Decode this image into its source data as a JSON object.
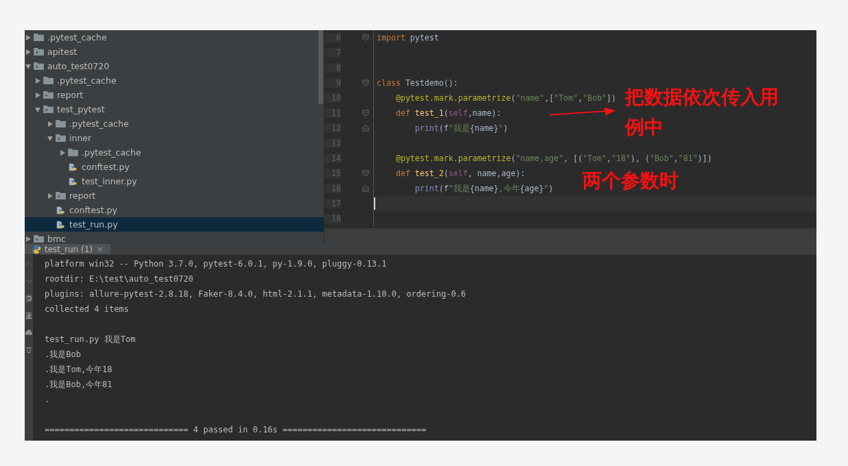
{
  "project_tree": [
    {
      "label": ".pytest_cache",
      "kind": "folder",
      "expanded": false,
      "selected": false
    },
    {
      "label": "apitest",
      "kind": "folder",
      "expanded": false,
      "selected": false
    },
    {
      "label": "auto_test0720",
      "kind": "folder",
      "expanded": true,
      "selected": false,
      "children": [
        {
          "label": ".pytest_cache",
          "kind": "folder",
          "expanded": false,
          "selected": false
        },
        {
          "label": "report",
          "kind": "folder",
          "expanded": false,
          "selected": false
        },
        {
          "label": "test_pytest",
          "kind": "folder",
          "expanded": true,
          "selected": false,
          "children": [
            {
              "label": ".pytest_cache",
              "kind": "folder",
              "expanded": false,
              "selected": false
            },
            {
              "label": "inner",
              "kind": "folder",
              "expanded": true,
              "selected": false,
              "children": [
                {
                  "label": ".pytest_cache",
                  "kind": "folder",
                  "expanded": false,
                  "selected": false
                },
                {
                  "label": "conftest.py",
                  "kind": "file",
                  "selected": false
                },
                {
                  "label": "test_inner.py",
                  "kind": "file",
                  "selected": false
                }
              ]
            },
            {
              "label": "report",
              "kind": "folder",
              "expanded": false,
              "selected": false
            },
            {
              "label": "conftest.py",
              "kind": "file",
              "selected": false
            },
            {
              "label": "test_run.py",
              "kind": "file",
              "selected": true
            }
          ]
        }
      ]
    },
    {
      "label": "bmc",
      "kind": "folder",
      "expanded": false,
      "selected": false
    }
  ],
  "editor": {
    "lines": [
      {
        "number": "6",
        "fold_end": false,
        "current": false,
        "tokens": [
          {
            "kind": "keyword",
            "text": "import"
          },
          {
            "kind": "plain",
            "text": " pytest"
          }
        ]
      },
      {
        "number": "7",
        "current": false
      },
      {
        "number": "8",
        "current": false
      },
      {
        "number": "9",
        "fold_end": false,
        "current": false,
        "tokens": [
          {
            "kind": "keyword",
            "text": "class"
          },
          {
            "kind": "plain",
            "text": " Testdemo():"
          }
        ]
      },
      {
        "number": "10",
        "current": false,
        "tokens": [
          {
            "kind": "decorator",
            "text": "    @pytest.mark.parametrize"
          },
          {
            "kind": "plain",
            "text": "("
          },
          {
            "kind": "string",
            "text": "\"name\""
          },
          {
            "kind": "plain",
            "text": ",["
          },
          {
            "kind": "string",
            "text": "\"Tom\""
          },
          {
            "kind": "plain",
            "text": ","
          },
          {
            "kind": "string",
            "text": "\"Bob\""
          },
          {
            "kind": "plain",
            "text": "])"
          }
        ]
      },
      {
        "number": "11",
        "fold_end": false,
        "current": false,
        "tokens": [
          {
            "kind": "keyword",
            "text": "    def "
          },
          {
            "kind": "function",
            "text": "test_1"
          },
          {
            "kind": "plain",
            "text": "("
          },
          {
            "kind": "self",
            "text": "self"
          },
          {
            "kind": "plain",
            "text": ",name):"
          }
        ]
      },
      {
        "number": "12",
        "fold_end": true,
        "current": false,
        "tokens": [
          {
            "kind": "builtin",
            "text": "        print"
          },
          {
            "kind": "plain",
            "text": "(f"
          },
          {
            "kind": "string",
            "text": "\"我是"
          },
          {
            "kind": "plain",
            "text": "{name}"
          },
          {
            "kind": "string",
            "text": "\""
          },
          {
            "kind": "plain",
            "text": ")"
          }
        ]
      },
      {
        "number": "13",
        "current": false
      },
      {
        "number": "14",
        "current": false,
        "tokens": [
          {
            "kind": "decorator",
            "text": "    @pytest.mark.parametrize"
          },
          {
            "kind": "plain",
            "text": "("
          },
          {
            "kind": "string",
            "text": "\"name,age\""
          },
          {
            "kind": "plain",
            "text": ", [("
          },
          {
            "kind": "string",
            "text": "\"Tom\""
          },
          {
            "kind": "plain",
            "text": ","
          },
          {
            "kind": "string",
            "text": "\"18\""
          },
          {
            "kind": "plain",
            "text": "), ("
          },
          {
            "kind": "string",
            "text": "\"Bob\""
          },
          {
            "kind": "plain",
            "text": ","
          },
          {
            "kind": "string",
            "text": "\"81\""
          },
          {
            "kind": "plain",
            "text": ")])"
          }
        ]
      },
      {
        "number": "15",
        "fold_end": false,
        "current": false,
        "tokens": [
          {
            "kind": "keyword",
            "text": "    def "
          },
          {
            "kind": "function",
            "text": "test_2"
          },
          {
            "kind": "plain",
            "text": "("
          },
          {
            "kind": "self",
            "text": "self"
          },
          {
            "kind": "plain",
            "text": ", name,age):"
          }
        ]
      },
      {
        "number": "16",
        "fold_end": true,
        "current": false,
        "tokens": [
          {
            "kind": "builtin",
            "text": "        print"
          },
          {
            "kind": "plain",
            "text": "(f"
          },
          {
            "kind": "string",
            "text": "\"我是"
          },
          {
            "kind": "plain",
            "text": "{name}"
          },
          {
            "kind": "string",
            "text": ",今年"
          },
          {
            "kind": "plain",
            "text": "{age}"
          },
          {
            "kind": "string",
            "text": "\""
          },
          {
            "kind": "plain",
            "text": ")"
          }
        ]
      },
      {
        "number": "17",
        "current": true
      },
      {
        "number": "18",
        "current": false
      }
    ],
    "annotations": [
      "把数据依次传入用例中",
      "两个参数时"
    ]
  },
  "run_panel": {
    "tab": {
      "label": "test_run (1)",
      "close": "×",
      "selected": true
    },
    "console_blocks": [
      [
        "platform win32 -- Python 3.7.0, pytest-6.0.1, py-1.9.0, pluggy-0.13.1",
        "rootdir: E:\\test\\auto_test0720",
        "plugins: allure-pytest-2.8.18, Faker-8.4.0, html-2.1.1, metadata-1.10.0, ordering-0.6",
        "collected 4 items"
      ],
      [
        "test_run.py 我是Tom",
        ".我是Bob",
        ".我是Tom,今年18",
        ".我是Bob,今年81",
        "."
      ],
      [
        "============================= 4 passed in 0.16s ============================="
      ]
    ]
  }
}
